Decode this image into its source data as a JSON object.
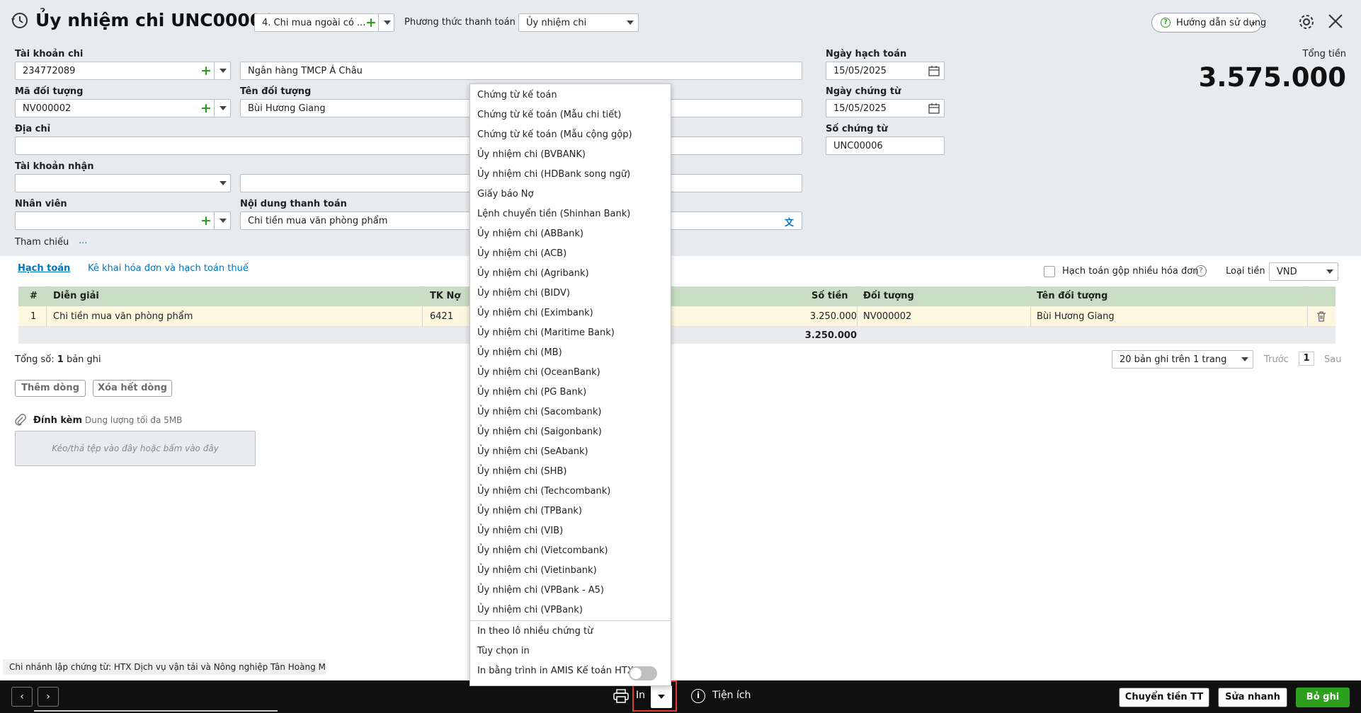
{
  "header": {
    "title": "Ủy nhiệm chi UNC00006",
    "voucher_type": "4. Chi mua ngoài có ...",
    "payment_method_label": "Phương thức thanh toán",
    "payment_method_value": "Ủy nhiệm chi",
    "help_label": "Hướng dẫn sử dụng"
  },
  "form": {
    "account_label": "Tài khoản chi",
    "account_value": "234772089",
    "bank_name": "Ngân hàng TMCP Á Châu",
    "object_code_label": "Mã đối tượng",
    "object_code_value": "NV000002",
    "object_name_label": "Tên đối tượng",
    "object_name_value": "Bùi Hương Giang",
    "address_label": "Địa chỉ",
    "receive_account_label": "Tài khoản nhận",
    "employee_label": "Nhân viên",
    "payment_content_label": "Nội dung thanh toán",
    "payment_content_value": "Chi tiền mua văn phòng phẩm",
    "reference_label": "Tham chiếu",
    "reference_more": "...",
    "posting_date_label": "Ngày hạch toán",
    "posting_date_value": "15/05/2025",
    "voucher_date_label": "Ngày chứng từ",
    "voucher_date_value": "15/05/2025",
    "voucher_no_label": "Số chứng từ",
    "voucher_no_value": "UNC00006",
    "total_label": "Tổng tiền",
    "total_value": "3.575.000"
  },
  "tabs": {
    "accounting": "Hạch toán",
    "invoice": "Kê khai hóa đơn và hạch toán thuế",
    "merge_label": "Hạch toán gộp nhiều hóa đơn",
    "currency_label": "Loại tiền",
    "currency_value": "VND"
  },
  "grid": {
    "headers": [
      "#",
      "Diễn giải",
      "TK Nợ",
      "Số tiền",
      "Đối tượng",
      "Tên đối tượng"
    ],
    "row": {
      "index": "1",
      "desc": "Chi tiền mua văn phòng phẩm",
      "debit": "6421",
      "amount": "3.250.000",
      "object": "NV000002",
      "object_name": "Bùi Hương Giang"
    },
    "sum_amount": "3.250.000",
    "total_prefix": "Tổng số:",
    "total_count": "1",
    "total_suffix": "bản ghi",
    "page_size": "20 bản ghi trên 1 trang",
    "prev": "Trước",
    "page": "1",
    "next": "Sau",
    "add_row": "Thêm dòng",
    "delete_rows": "Xóa hết dòng"
  },
  "attach": {
    "label": "Đính kèm",
    "hint": "Dung lượng tối đa 5MB",
    "drop": "Kéo/thả tệp vào đây hoặc bấm vào đây"
  },
  "branch_note": "Chi nhánh lập chứng từ: HTX Dịch vụ vận tải và Nông nghiệp Tân Hoàng Minh",
  "dropdown": {
    "items": [
      "Chứng từ kế toán",
      "Chứng từ kế toán (Mẫu chi tiết)",
      "Chứng từ kế toán (Mẫu cộng gộp)",
      "Ủy nhiệm chi (BVBANK)",
      "Ủy nhiệm chi (HDBank song ngữ)",
      "Giấy báo Nợ",
      "Lệnh chuyển tiền (Shinhan Bank)",
      "Ủy nhiệm chi (ABBank)",
      "Ủy nhiệm chi (ACB)",
      "Ủy nhiệm chi (Agribank)",
      "Ủy nhiệm chi (BIDV)",
      "Ủy nhiệm chi (Eximbank)",
      "Ủy nhiệm chi (Maritime Bank)",
      "Ủy nhiệm chi (MB)",
      "Ủy nhiệm chi (OceanBank)",
      "Ủy nhiệm chi (PG Bank)",
      "Ủy nhiệm chi (Sacombank)",
      "Ủy nhiệm chi (Saigonbank)",
      "Ủy nhiệm chi (SeAbank)",
      "Ủy nhiệm chi (SHB)",
      "Ủy nhiệm chi (Techcombank)",
      "Ủy nhiệm chi (TPBank)",
      "Ủy nhiệm chi (VIB)",
      "Ủy nhiệm chi (Vietcombank)",
      "Ủy nhiệm chi (Vietinbank)",
      "Ủy nhiệm chi (VPBank - A5)",
      "Ủy nhiệm chi (VPBank)"
    ],
    "extra": [
      "In theo lô nhiều chứng từ",
      "Tùy chọn in"
    ],
    "toggle_label": "In bằng trình in AMIS Kế toán HTX"
  },
  "footer": {
    "print": "In",
    "utilities": "Tiện ích",
    "transfer": "Chuyển tiền TT",
    "quick_edit": "Sửa nhanh",
    "save": "Bỏ ghi"
  },
  "colors": {
    "accent_green": "#2ca01c",
    "highlight_red": "#e53935",
    "link_blue": "#0075c0"
  }
}
